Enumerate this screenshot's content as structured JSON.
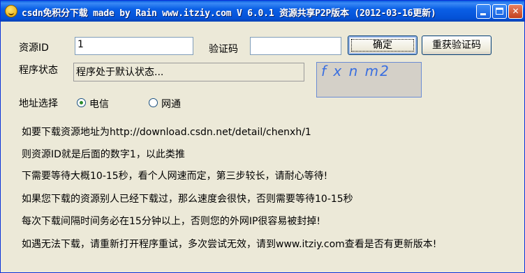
{
  "window": {
    "title": "csdn免积分下载 made by Rain www.itziy.com V 6.0.1 资源共享P2P版本 (2012-03-16更新)"
  },
  "form": {
    "resource_id_label": "资源ID",
    "resource_id_value": "1",
    "captcha_label": "验证码",
    "captcha_value": "",
    "confirm_label": "确定",
    "refresh_captcha_label": "重获验证码",
    "status_label": "程序状态",
    "status_value": "程序处于默认状态...",
    "captcha_image_text": "f x n m2",
    "address_label": "地址选择",
    "options": [
      "电信",
      "网通"
    ],
    "selected_option": "电信"
  },
  "info_lines": [
    "如要下载资源地址为http://download.csdn.net/detail/chenxh/1",
    "则资源ID就是后面的数字1，以此类推",
    "下需要等待大概10-15秒，看个人网速而定，第三步较长，请耐心等待!",
    "如果您下载的资源别人已经下载过，那么速度会很快，否则需要等待10-15秒",
    "每次下载间隔时间务必在15分钟以上，否则您的外网IP很容易被封掉!",
    "如遇无法下载，请重新打开程序重试，多次尝试无效，请到www.itziy.com查看是否有更新版本!"
  ],
  "colors": {
    "titlebar": "#0451d6",
    "window_bg": "#ece9d8",
    "captcha_text": "#3a6fe0"
  }
}
